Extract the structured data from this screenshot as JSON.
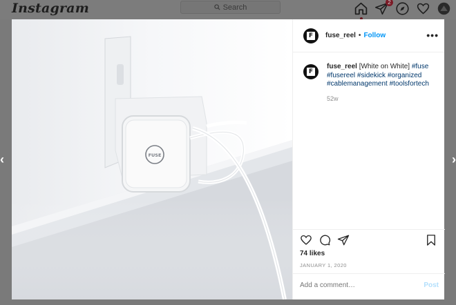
{
  "app": {
    "brand": "Instagram"
  },
  "search": {
    "placeholder": "Search"
  },
  "nav": {
    "activity_badge": "2"
  },
  "post": {
    "username": "fuse_reel",
    "separator": "•",
    "follow_label": "Follow",
    "more_label": "•••",
    "avatar_letter": "F",
    "caption_text": " [White on White] ",
    "hashtags": [
      "#fuse",
      "#fusereel",
      "#sidekick",
      "#organized",
      "#cablemanagement",
      "#toolsfortech"
    ],
    "caption_age": "52w",
    "likes": "74 likes",
    "date": "JANUARY 1, 2020",
    "comment_placeholder": "Add a comment…",
    "post_label": "Post",
    "photo_logo": "FUSE"
  },
  "colors": {
    "link": "#0095f6",
    "hashtag": "#00376b",
    "overlay": "#7a7a7a"
  },
  "icons": [
    "home-icon",
    "direct-icon",
    "explore-icon",
    "heart-icon",
    "avatar",
    "search-icon",
    "comment-icon",
    "share-icon",
    "bookmark-icon",
    "chevron-left-icon",
    "chevron-right-icon"
  ]
}
